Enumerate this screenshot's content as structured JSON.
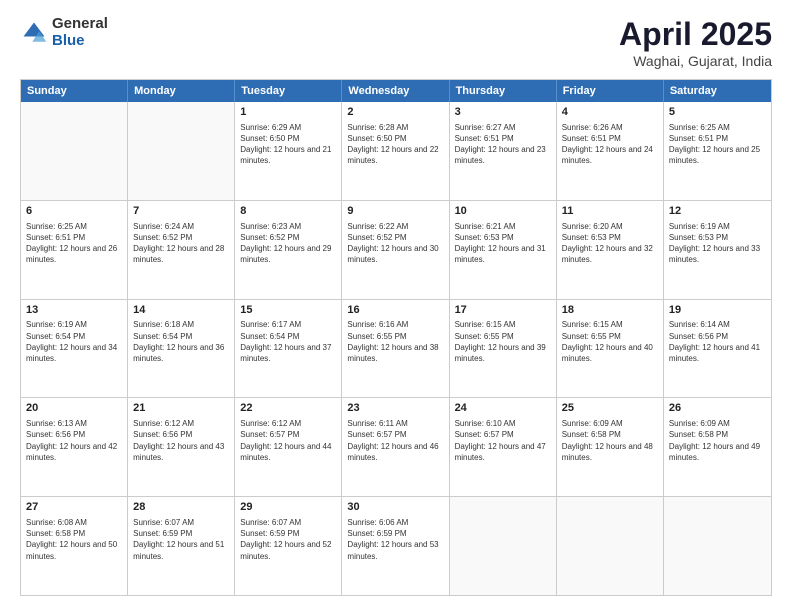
{
  "logo": {
    "general": "General",
    "blue": "Blue"
  },
  "title": {
    "month": "April 2025",
    "location": "Waghai, Gujarat, India"
  },
  "header_days": [
    "Sunday",
    "Monday",
    "Tuesday",
    "Wednesday",
    "Thursday",
    "Friday",
    "Saturday"
  ],
  "weeks": [
    [
      {
        "day": "",
        "sunrise": "",
        "sunset": "",
        "daylight": ""
      },
      {
        "day": "",
        "sunrise": "",
        "sunset": "",
        "daylight": ""
      },
      {
        "day": "1",
        "sunrise": "Sunrise: 6:29 AM",
        "sunset": "Sunset: 6:50 PM",
        "daylight": "Daylight: 12 hours and 21 minutes."
      },
      {
        "day": "2",
        "sunrise": "Sunrise: 6:28 AM",
        "sunset": "Sunset: 6:50 PM",
        "daylight": "Daylight: 12 hours and 22 minutes."
      },
      {
        "day": "3",
        "sunrise": "Sunrise: 6:27 AM",
        "sunset": "Sunset: 6:51 PM",
        "daylight": "Daylight: 12 hours and 23 minutes."
      },
      {
        "day": "4",
        "sunrise": "Sunrise: 6:26 AM",
        "sunset": "Sunset: 6:51 PM",
        "daylight": "Daylight: 12 hours and 24 minutes."
      },
      {
        "day": "5",
        "sunrise": "Sunrise: 6:25 AM",
        "sunset": "Sunset: 6:51 PM",
        "daylight": "Daylight: 12 hours and 25 minutes."
      }
    ],
    [
      {
        "day": "6",
        "sunrise": "Sunrise: 6:25 AM",
        "sunset": "Sunset: 6:51 PM",
        "daylight": "Daylight: 12 hours and 26 minutes."
      },
      {
        "day": "7",
        "sunrise": "Sunrise: 6:24 AM",
        "sunset": "Sunset: 6:52 PM",
        "daylight": "Daylight: 12 hours and 28 minutes."
      },
      {
        "day": "8",
        "sunrise": "Sunrise: 6:23 AM",
        "sunset": "Sunset: 6:52 PM",
        "daylight": "Daylight: 12 hours and 29 minutes."
      },
      {
        "day": "9",
        "sunrise": "Sunrise: 6:22 AM",
        "sunset": "Sunset: 6:52 PM",
        "daylight": "Daylight: 12 hours and 30 minutes."
      },
      {
        "day": "10",
        "sunrise": "Sunrise: 6:21 AM",
        "sunset": "Sunset: 6:53 PM",
        "daylight": "Daylight: 12 hours and 31 minutes."
      },
      {
        "day": "11",
        "sunrise": "Sunrise: 6:20 AM",
        "sunset": "Sunset: 6:53 PM",
        "daylight": "Daylight: 12 hours and 32 minutes."
      },
      {
        "day": "12",
        "sunrise": "Sunrise: 6:19 AM",
        "sunset": "Sunset: 6:53 PM",
        "daylight": "Daylight: 12 hours and 33 minutes."
      }
    ],
    [
      {
        "day": "13",
        "sunrise": "Sunrise: 6:19 AM",
        "sunset": "Sunset: 6:54 PM",
        "daylight": "Daylight: 12 hours and 34 minutes."
      },
      {
        "day": "14",
        "sunrise": "Sunrise: 6:18 AM",
        "sunset": "Sunset: 6:54 PM",
        "daylight": "Daylight: 12 hours and 36 minutes."
      },
      {
        "day": "15",
        "sunrise": "Sunrise: 6:17 AM",
        "sunset": "Sunset: 6:54 PM",
        "daylight": "Daylight: 12 hours and 37 minutes."
      },
      {
        "day": "16",
        "sunrise": "Sunrise: 6:16 AM",
        "sunset": "Sunset: 6:55 PM",
        "daylight": "Daylight: 12 hours and 38 minutes."
      },
      {
        "day": "17",
        "sunrise": "Sunrise: 6:15 AM",
        "sunset": "Sunset: 6:55 PM",
        "daylight": "Daylight: 12 hours and 39 minutes."
      },
      {
        "day": "18",
        "sunrise": "Sunrise: 6:15 AM",
        "sunset": "Sunset: 6:55 PM",
        "daylight": "Daylight: 12 hours and 40 minutes."
      },
      {
        "day": "19",
        "sunrise": "Sunrise: 6:14 AM",
        "sunset": "Sunset: 6:56 PM",
        "daylight": "Daylight: 12 hours and 41 minutes."
      }
    ],
    [
      {
        "day": "20",
        "sunrise": "Sunrise: 6:13 AM",
        "sunset": "Sunset: 6:56 PM",
        "daylight": "Daylight: 12 hours and 42 minutes."
      },
      {
        "day": "21",
        "sunrise": "Sunrise: 6:12 AM",
        "sunset": "Sunset: 6:56 PM",
        "daylight": "Daylight: 12 hours and 43 minutes."
      },
      {
        "day": "22",
        "sunrise": "Sunrise: 6:12 AM",
        "sunset": "Sunset: 6:57 PM",
        "daylight": "Daylight: 12 hours and 44 minutes."
      },
      {
        "day": "23",
        "sunrise": "Sunrise: 6:11 AM",
        "sunset": "Sunset: 6:57 PM",
        "daylight": "Daylight: 12 hours and 46 minutes."
      },
      {
        "day": "24",
        "sunrise": "Sunrise: 6:10 AM",
        "sunset": "Sunset: 6:57 PM",
        "daylight": "Daylight: 12 hours and 47 minutes."
      },
      {
        "day": "25",
        "sunrise": "Sunrise: 6:09 AM",
        "sunset": "Sunset: 6:58 PM",
        "daylight": "Daylight: 12 hours and 48 minutes."
      },
      {
        "day": "26",
        "sunrise": "Sunrise: 6:09 AM",
        "sunset": "Sunset: 6:58 PM",
        "daylight": "Daylight: 12 hours and 49 minutes."
      }
    ],
    [
      {
        "day": "27",
        "sunrise": "Sunrise: 6:08 AM",
        "sunset": "Sunset: 6:58 PM",
        "daylight": "Daylight: 12 hours and 50 minutes."
      },
      {
        "day": "28",
        "sunrise": "Sunrise: 6:07 AM",
        "sunset": "Sunset: 6:59 PM",
        "daylight": "Daylight: 12 hours and 51 minutes."
      },
      {
        "day": "29",
        "sunrise": "Sunrise: 6:07 AM",
        "sunset": "Sunset: 6:59 PM",
        "daylight": "Daylight: 12 hours and 52 minutes."
      },
      {
        "day": "30",
        "sunrise": "Sunrise: 6:06 AM",
        "sunset": "Sunset: 6:59 PM",
        "daylight": "Daylight: 12 hours and 53 minutes."
      },
      {
        "day": "",
        "sunrise": "",
        "sunset": "",
        "daylight": ""
      },
      {
        "day": "",
        "sunrise": "",
        "sunset": "",
        "daylight": ""
      },
      {
        "day": "",
        "sunrise": "",
        "sunset": "",
        "daylight": ""
      }
    ]
  ]
}
